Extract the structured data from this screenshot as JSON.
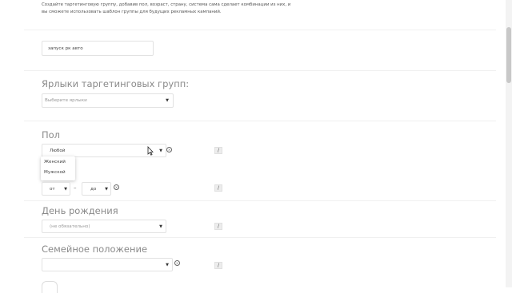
{
  "intro_text": "Создайте таргетинговую группу, добавив пол, возраст, страну, система сама сделает комбинации из них, и вы сможете использовать шаблон группы для будущих рекламных кампаний.",
  "campaign_name_value": "запуск рк авто",
  "labels_section": {
    "title": "Ярлыки таргетинговых групп:",
    "select_placeholder": "Выберите ярлыки"
  },
  "gender_section": {
    "title": "Пол",
    "selected": "Любой",
    "options": [
      "Женский",
      "Мужской"
    ]
  },
  "age_section": {
    "from_label": "от",
    "separator": "–",
    "to_label": "до"
  },
  "birthday_section": {
    "title": "День рождения",
    "placeholder": "(не обязательно)"
  },
  "marital_section": {
    "title": "Семейное положение",
    "selected": ""
  },
  "icons": {
    "caret": "caret-down-icon",
    "clear": "clear-circle-icon",
    "edit": "pencil-edit-icon",
    "cursor": "mouse-pointer-icon"
  }
}
